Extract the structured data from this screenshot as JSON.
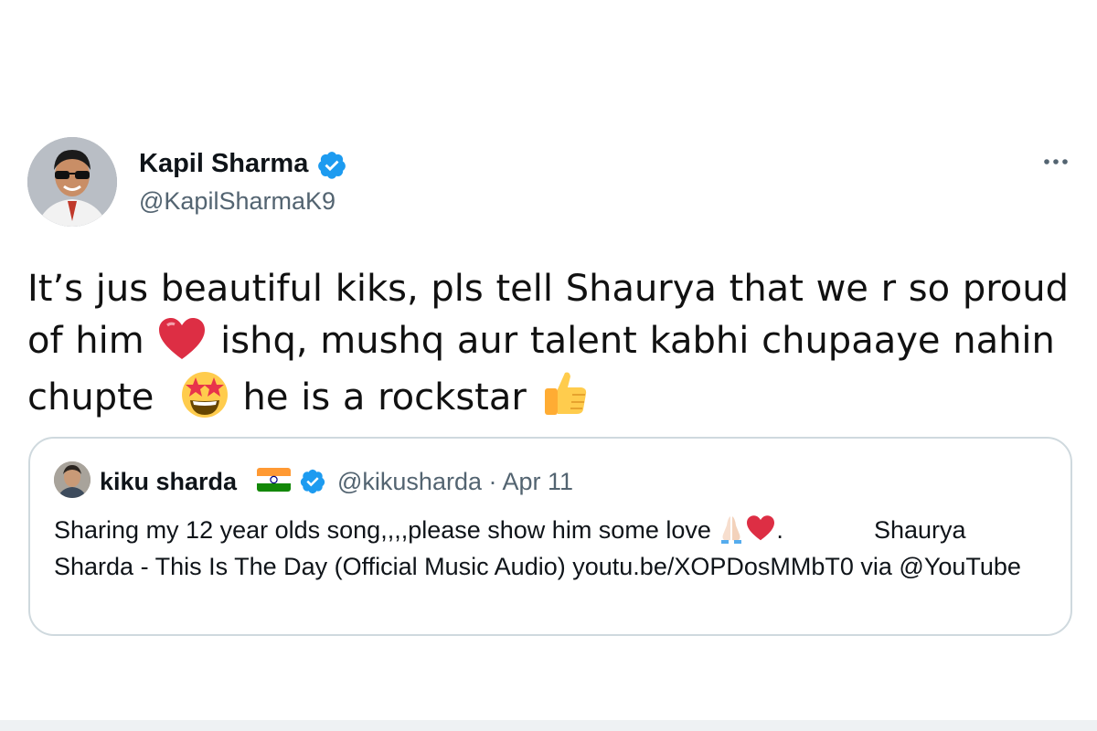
{
  "tweet": {
    "author": {
      "name": "Kapil Sharma",
      "handle": "@KapilSharmaK9",
      "verified": true,
      "avatar_icon": "profile-photo"
    },
    "more_icon": "more-dots-icon",
    "text": {
      "line1": "It’s jus beautiful kiks, pls tell Shaurya that we r so proud",
      "line2_a": "of him",
      "line2_b": "ishq, mushq aur talent kabhi chupaaye nahin",
      "line3_a": "chupte",
      "line3_b": "he is a rockstar"
    },
    "emojis": [
      "red-heart",
      "star-struck-face",
      "thumbs-up"
    ]
  },
  "quoted_tweet": {
    "author": {
      "name": "kiku sharda",
      "handle": "@kikusharda",
      "date": "Apr 11",
      "flag": "india-flag",
      "verified": true
    },
    "text": {
      "part1": "Sharing my 12 year olds song,,,,please show him some love",
      "part2": ".",
      "part3": "Shaurya Sharda - This Is The Day (Official Music Audio)",
      "link": "youtu.be/XOPDosMMbT0",
      "part4": "via @YouTube"
    },
    "emojis": [
      "folded-hands",
      "red-heart"
    ]
  },
  "colors": {
    "verified_blue": "#1d9bf0",
    "secondary_text": "#536471",
    "border": "#cfd9de"
  }
}
